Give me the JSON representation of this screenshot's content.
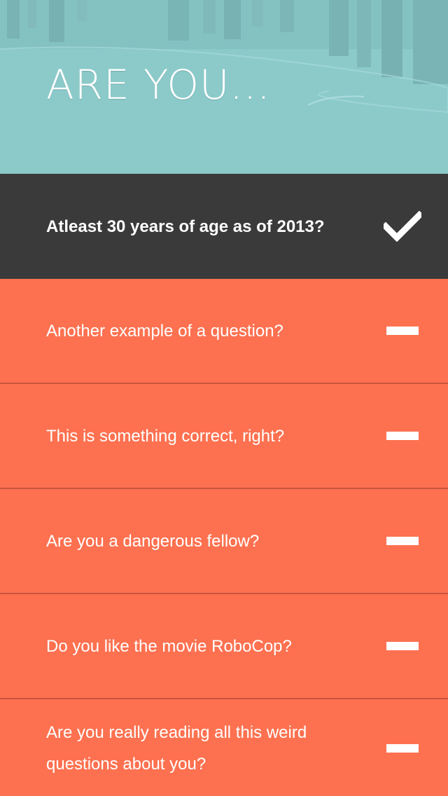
{
  "header": {
    "title": "ARE YOU..."
  },
  "colors": {
    "header_bg": "#8ccaca",
    "selected_row_bg": "#3a3a3a",
    "row_bg": "#fd7150",
    "divider": "#c9553c",
    "text": "#ffffff"
  },
  "questions": [
    {
      "text": "Atleast 30 years of age as of 2013?",
      "state": "checked",
      "icon": "checkmark-icon"
    },
    {
      "text": "Another example of a question?",
      "state": "unchecked",
      "icon": "dash-icon"
    },
    {
      "text": "This is something correct, right?",
      "state": "unchecked",
      "icon": "dash-icon"
    },
    {
      "text": "Are you a dangerous fellow?",
      "state": "unchecked",
      "icon": "dash-icon"
    },
    {
      "text": "Do you like the movie RoboCop?",
      "state": "unchecked",
      "icon": "dash-icon"
    },
    {
      "text": "Are you really reading all this weird questions about you?",
      "state": "unchecked",
      "icon": "dash-icon"
    }
  ]
}
